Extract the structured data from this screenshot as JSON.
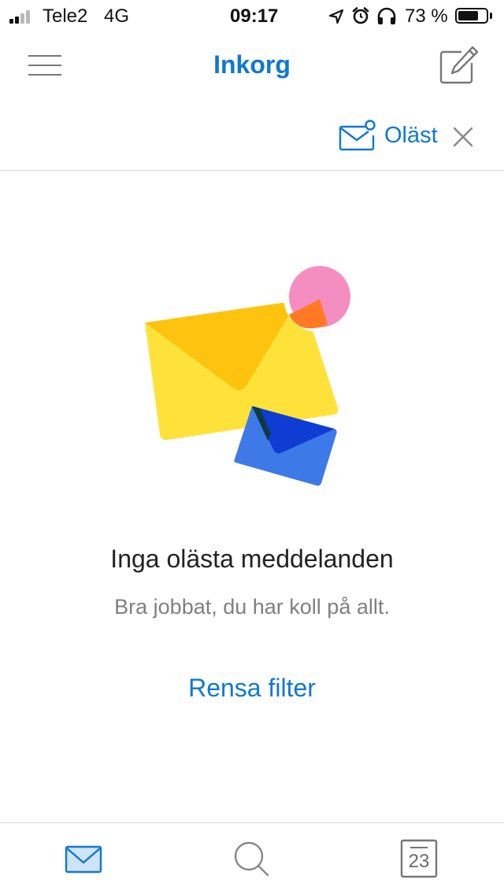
{
  "status_bar": {
    "carrier": "Tele2",
    "network": "4G",
    "time": "09:17",
    "battery_percent": "73 %",
    "battery_level": 0.73,
    "icons": [
      "signal-icon",
      "location-arrow-icon",
      "alarm-icon",
      "headphones-icon",
      "battery-icon"
    ]
  },
  "header": {
    "title": "Inkorg",
    "menu_icon": "hamburger-menu-icon",
    "compose_icon": "compose-icon"
  },
  "filter": {
    "label": "Oläst",
    "icon": "unread-mail-icon",
    "close_icon": "close-icon"
  },
  "empty_state": {
    "illustration": "envelopes-illustration",
    "title": "Inga olästa meddelanden",
    "subtitle": "Bra jobbat, du har koll på allt.",
    "action": "Rensa filter"
  },
  "tab_bar": {
    "tabs": [
      {
        "icon": "mail-icon",
        "active": true
      },
      {
        "icon": "search-icon",
        "active": false
      },
      {
        "icon": "calendar-icon",
        "active": false,
        "day": "23"
      }
    ]
  },
  "colors": {
    "accent": "#0f78d4",
    "envelope_yellow": "#fee23a",
    "envelope_blue": "#3d7ae8",
    "badge_pink": "#f58ec0",
    "badge_orange": "#ff7a22"
  }
}
